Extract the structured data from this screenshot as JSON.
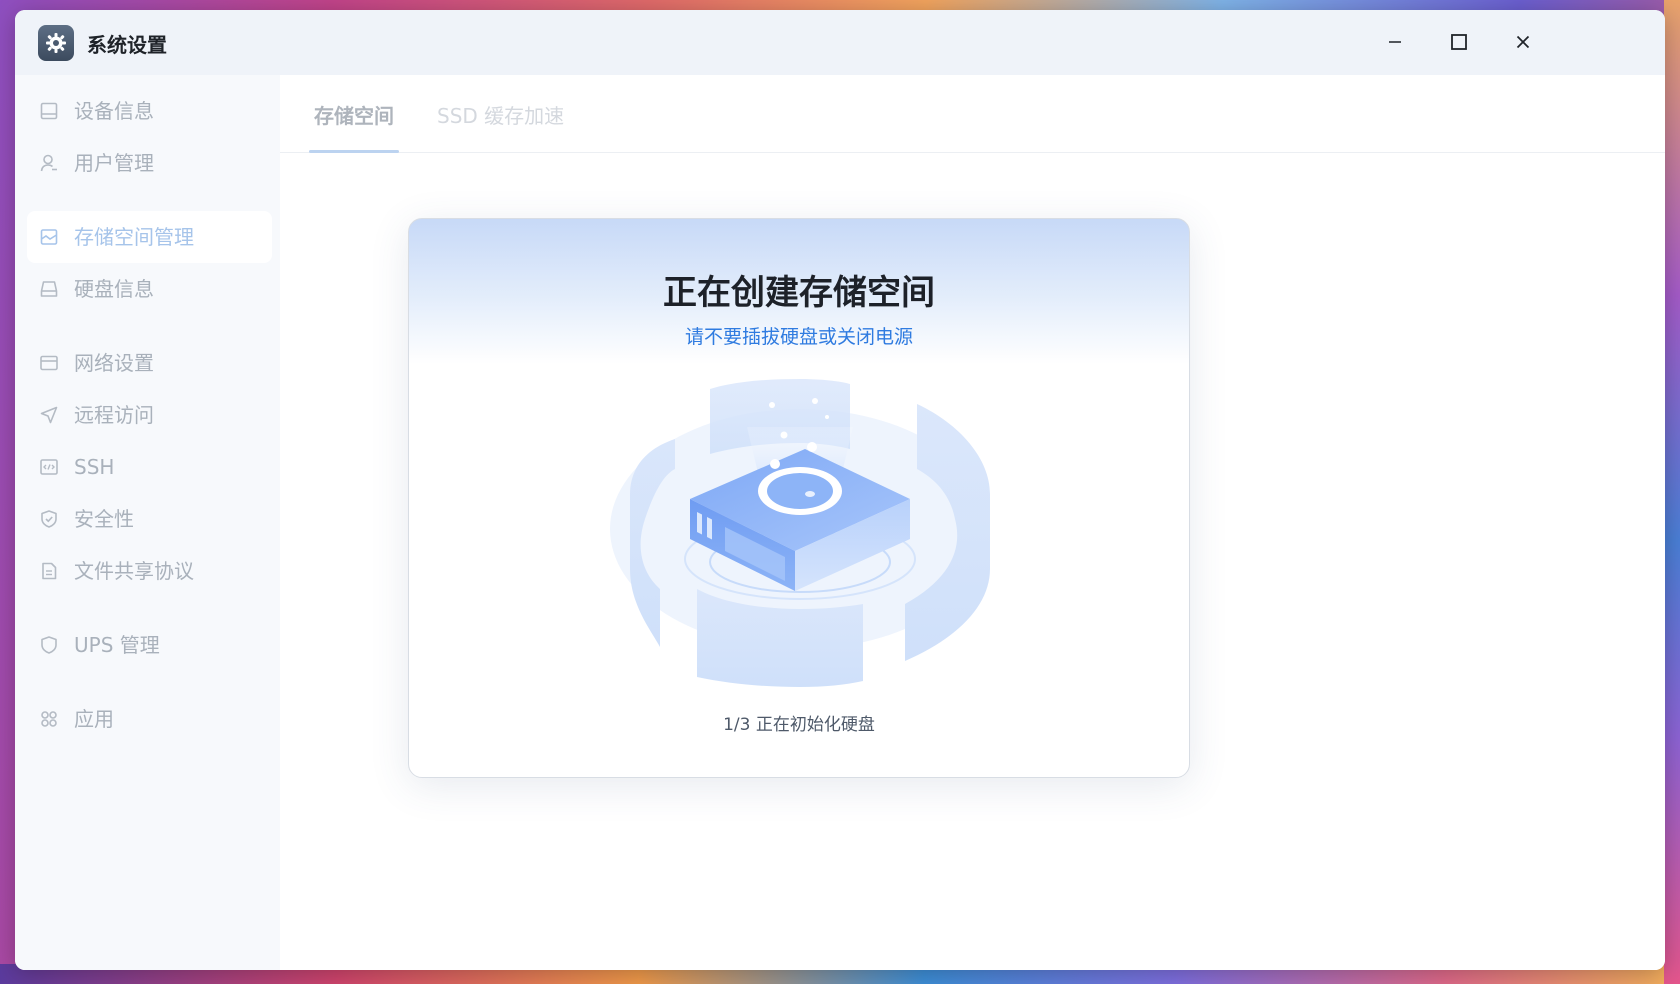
{
  "window": {
    "title": "系统设置",
    "app_icon": "gear-icon",
    "controls": [
      "minimize-icon",
      "maximize-icon",
      "close-icon"
    ]
  },
  "sidebar": {
    "items": [
      {
        "label": "设备信息",
        "icon": "device-icon"
      },
      {
        "label": "用户管理",
        "icon": "user-icon"
      },
      {
        "label": "存储空间管理",
        "icon": "storage-icon",
        "active": true
      },
      {
        "label": "硬盘信息",
        "icon": "disk-icon"
      },
      {
        "label": "网络设置",
        "icon": "network-icon"
      },
      {
        "label": "远程访问",
        "icon": "send-icon"
      },
      {
        "label": "SSH",
        "icon": "code-icon"
      },
      {
        "label": "安全性",
        "icon": "shield-check-icon"
      },
      {
        "label": "文件共享协议",
        "icon": "file-icon"
      },
      {
        "label": "UPS 管理",
        "icon": "shield-icon"
      },
      {
        "label": "应用",
        "icon": "apps-icon"
      }
    ]
  },
  "tabs": [
    {
      "label": "存储空间",
      "active": true
    },
    {
      "label": "SSD 缓存加速",
      "active": false
    }
  ],
  "dialog": {
    "title": "正在创建存储空间",
    "subtitle": "请不要插拔硬盘或关闭电源",
    "illustration": "disk-initializing-illustration",
    "progress_text": "1/3 正在初始化硬盘"
  },
  "colors": {
    "accent": "#2f7be0",
    "sidebar_bg": "#f7f9fc",
    "titlebar_bg": "#eff3f9"
  }
}
